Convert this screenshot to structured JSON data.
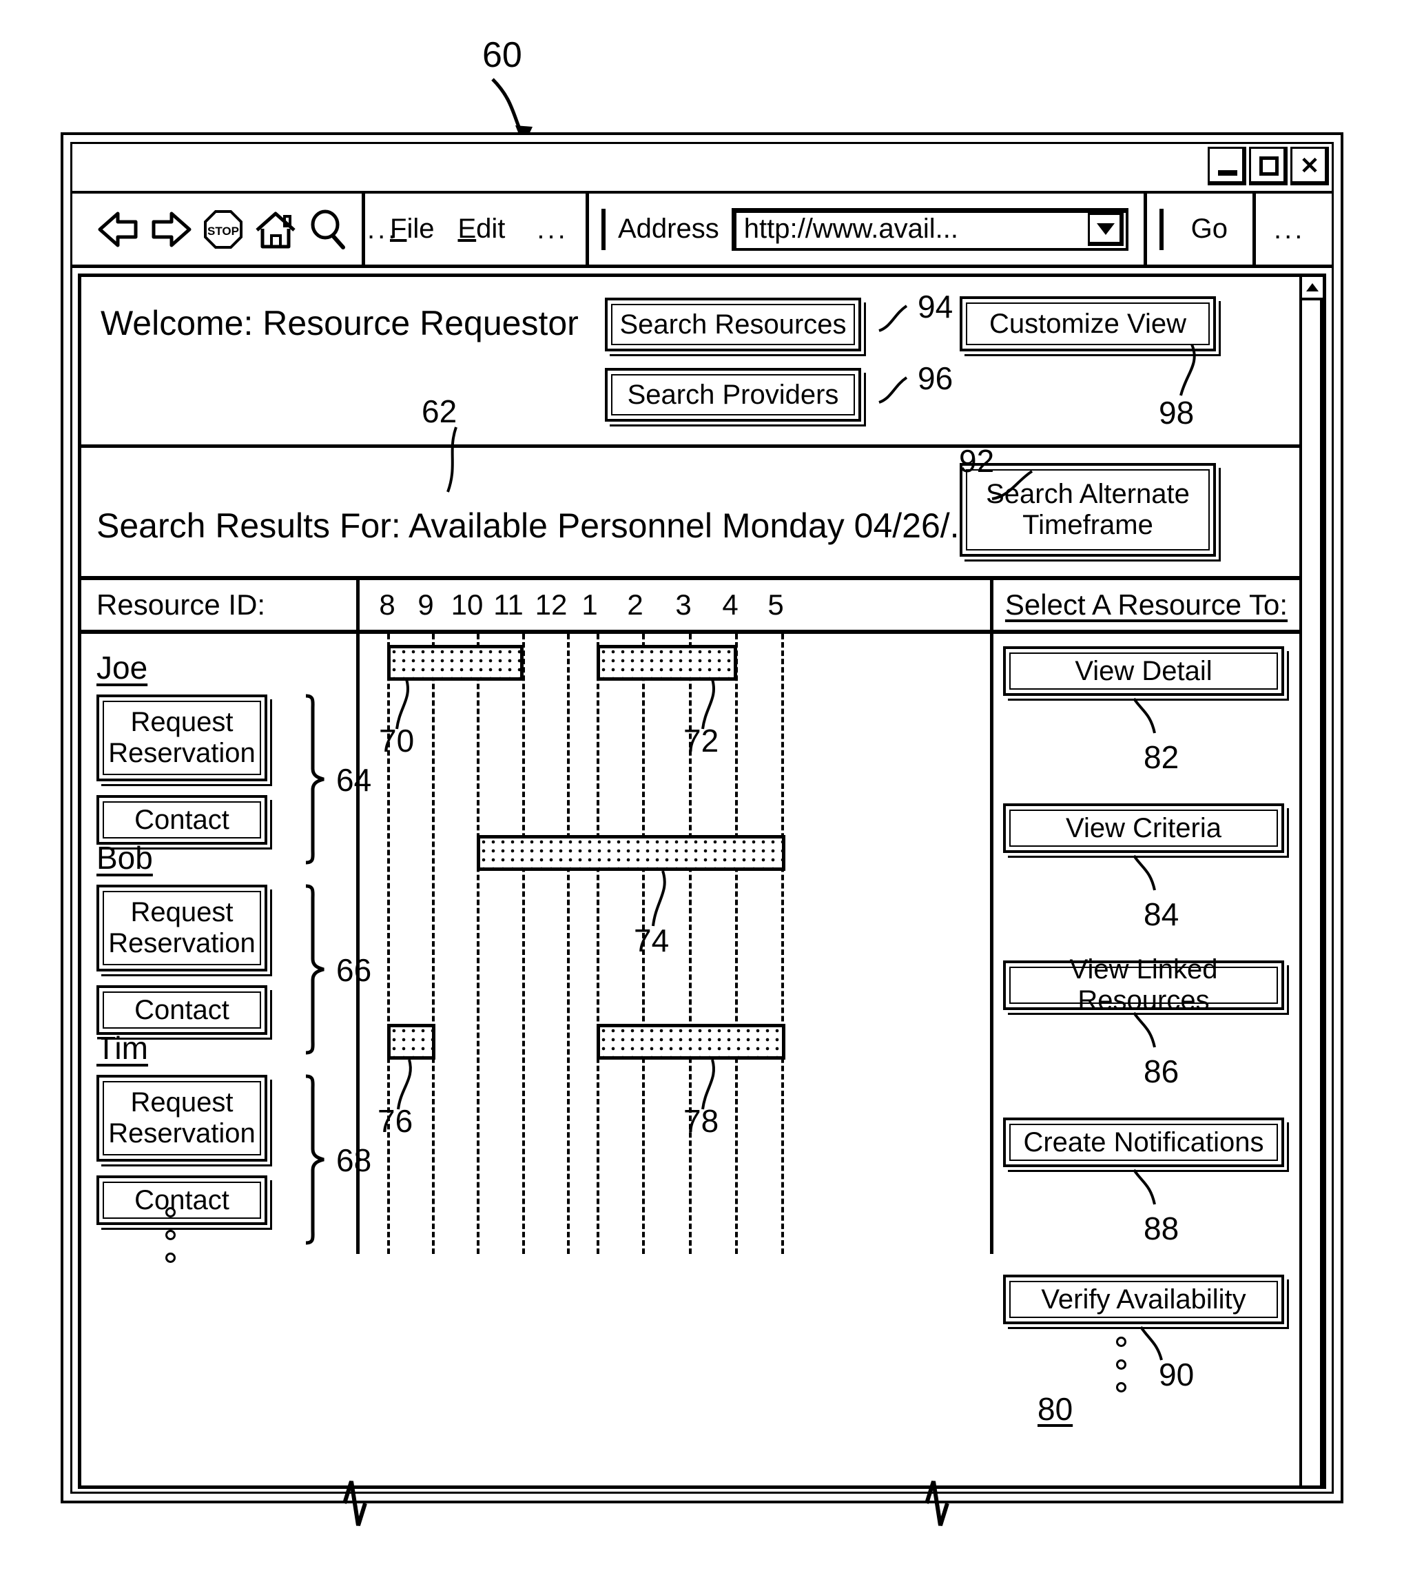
{
  "figure": {
    "main_label": "60",
    "callouts": {
      "welcome_band": "62",
      "joe_group": "64",
      "bob_group": "66",
      "tim_group": "68",
      "bar_joe_morning": "70",
      "bar_joe_afternoon": "72",
      "bar_bob": "74",
      "bar_tim_morning": "76",
      "bar_tim_afternoon": "78",
      "actions_panel": "80",
      "view_detail": "82",
      "view_criteria": "84",
      "view_linked_resources": "86",
      "create_notifications": "88",
      "verify_availability": "90",
      "search_alternate_timeframe": "92",
      "search_resources": "94",
      "search_providers": "96",
      "customize_view": "98"
    }
  },
  "browser": {
    "window_controls": {
      "minimize": "_",
      "maximize": "□",
      "close": "✕"
    },
    "toolbar": {
      "icons": [
        "back-arrow-icon",
        "forward-arrow-icon",
        "stop-icon",
        "home-icon",
        "search-icon"
      ],
      "stop_label": "STOP",
      "overflow": "...",
      "menus": [
        {
          "label": "File",
          "accelerator": "F",
          "rest": "ile"
        },
        {
          "label": "Edit",
          "accelerator": "E",
          "rest": "dit"
        }
      ],
      "menu_overflow": "...",
      "address_label": "Address",
      "address_value": "http://www.avail...",
      "address_placeholder": "http://",
      "go_label": "Go",
      "trailing_overflow": "..."
    }
  },
  "page": {
    "welcome": "Welcome: Resource Requestor",
    "header_buttons": [
      {
        "id": "search-resources",
        "label": "Search Resources"
      },
      {
        "id": "search-providers",
        "label": "Search Providers"
      },
      {
        "id": "customize-view",
        "label": "Customize View"
      }
    ],
    "results_text": "Search Results For: Available Personnel Monday 04/26/....",
    "search_alternate_label_line1": "Search Alternate",
    "search_alternate_label_line2": "Timeframe",
    "resource_column_header": "Resource ID:",
    "actions_panel_title": "Select A Resource To:",
    "resource_row_buttons": {
      "request_line1": "Request",
      "request_line2": "Reservation",
      "contact": "Contact"
    },
    "actions": [
      {
        "id": "view-detail",
        "label": "View Detail"
      },
      {
        "id": "view-criteria",
        "label": "View Criteria"
      },
      {
        "id": "view-linked-resources",
        "label": "View Linked Resources"
      },
      {
        "id": "create-notifications",
        "label": "Create Notifications"
      },
      {
        "id": "verify-availability",
        "label": "Verify Availability"
      }
    ]
  },
  "chart_data": {
    "type": "bar",
    "title": "Available Personnel Monday 04/26/....",
    "xlabel": "",
    "ylabel": "Resource ID:",
    "orientation": "horizontal",
    "grid": true,
    "x_tick_labels": [
      "8",
      "9",
      "10",
      "11",
      "12",
      "1",
      "2",
      "3",
      "4",
      "5"
    ],
    "x_hours_24": [
      8,
      9,
      10,
      11,
      12,
      13,
      14,
      15,
      16,
      17
    ],
    "xlim": [
      8,
      17
    ],
    "categories": [
      "Joe",
      "Bob",
      "Tim"
    ],
    "series": [
      {
        "name": "Joe",
        "bars": [
          {
            "ref": "70",
            "start": 8,
            "end": 11
          },
          {
            "ref": "72",
            "start": 13,
            "end": 16
          }
        ]
      },
      {
        "name": "Bob",
        "bars": [
          {
            "ref": "74",
            "start": 10,
            "end": 17
          }
        ]
      },
      {
        "name": "Tim",
        "bars": [
          {
            "ref": "76",
            "start": 8,
            "end": 9
          },
          {
            "ref": "78",
            "start": 13,
            "end": 17
          }
        ]
      }
    ]
  }
}
